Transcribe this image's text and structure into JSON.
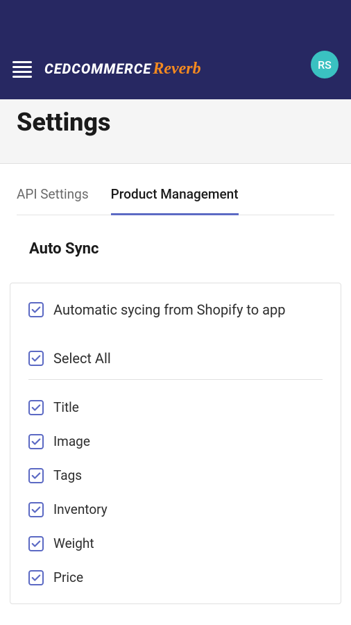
{
  "header": {
    "logo_ced": "CEDCOMMERCE",
    "logo_reverb": "Reverb",
    "avatar_initials": "RS"
  },
  "page": {
    "title": "Settings"
  },
  "tabs": {
    "api_settings": "API Settings",
    "product_management": "Product Management"
  },
  "autosync": {
    "title": "Auto Sync",
    "automatic_sync": "Automatic sycing from Shopify to app",
    "select_all": "Select All",
    "fields": [
      "Title",
      "Image",
      "Tags",
      "Inventory",
      "Weight",
      "Price"
    ]
  }
}
